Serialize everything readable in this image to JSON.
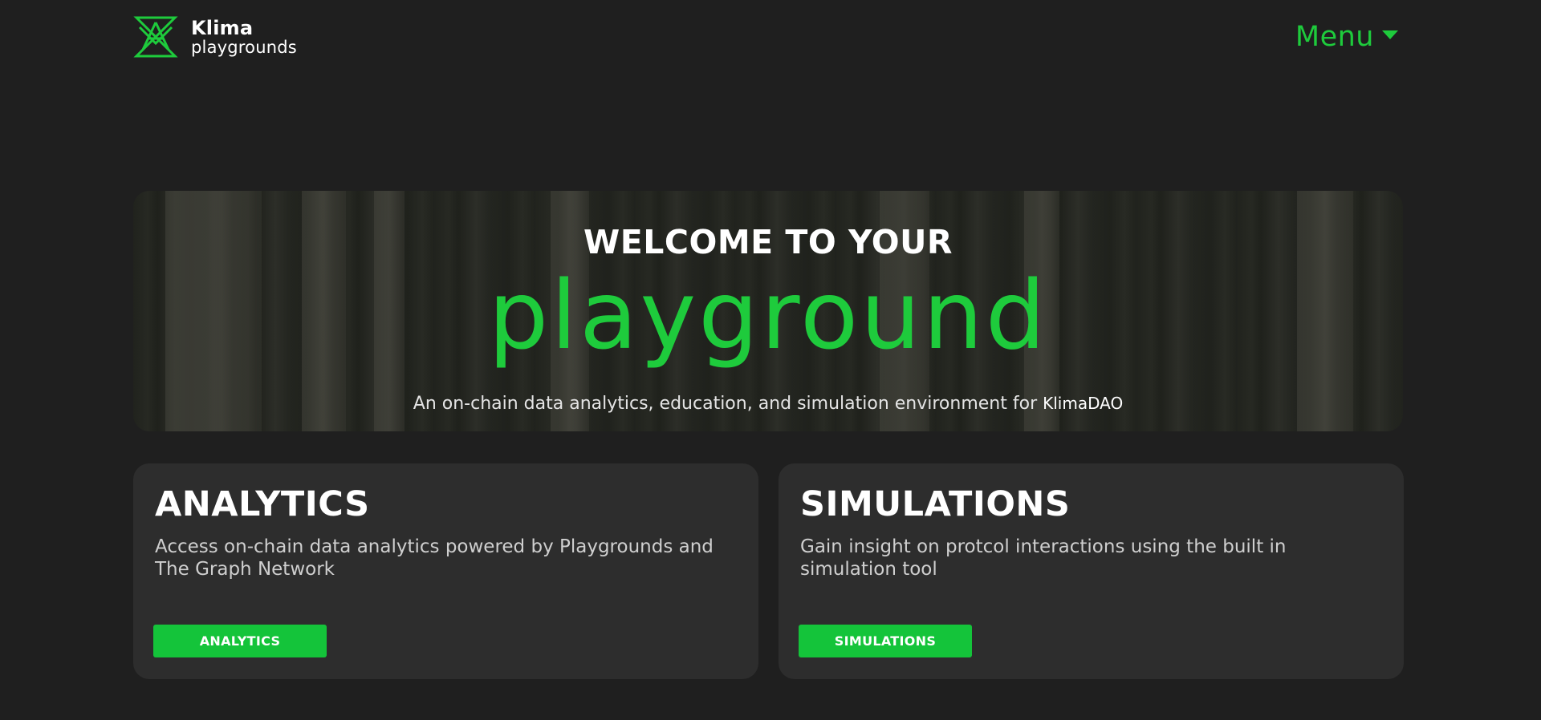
{
  "colors": {
    "background": "#1f1f1f",
    "accent": "#1ecb3c",
    "card": "#2d2d2d",
    "button": "#14c43a"
  },
  "header": {
    "brand_name": "Klima",
    "brand_sub": "playgrounds",
    "logo_icon": "klima-logo-icon",
    "menu_label": "Menu",
    "menu_icon": "caret-down-icon"
  },
  "hero": {
    "title": "WELCOME TO YOUR",
    "word": "playground",
    "tagline": "An on-chain data analytics, education, and simulation environment for",
    "tagline_brand": "KlimaDAO"
  },
  "cards": [
    {
      "title": "ANALYTICS",
      "description": "Access on-chain data analytics powered by Playgrounds and The Graph Network",
      "button_label": "ANALYTICS"
    },
    {
      "title": "SIMULATIONS",
      "description": "Gain insight on protcol interactions using the built in simulation tool",
      "button_label": "SIMULATIONS"
    }
  ]
}
